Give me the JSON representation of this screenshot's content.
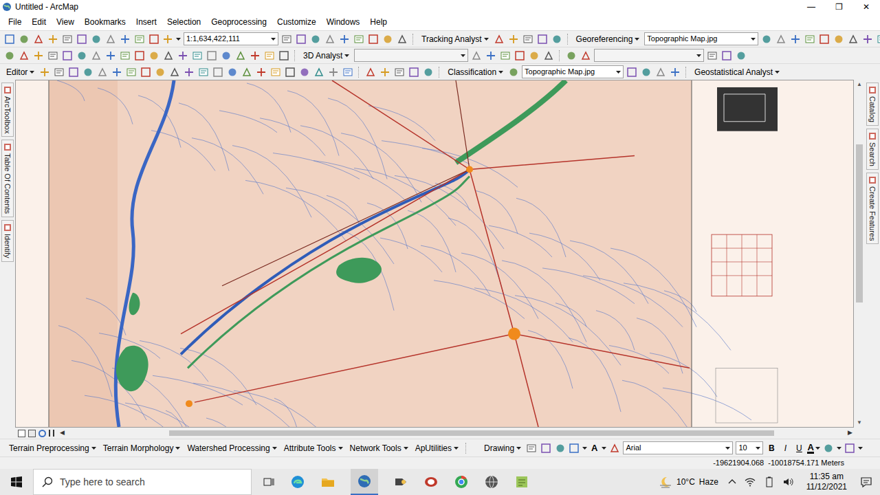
{
  "window": {
    "title": "Untitled - ArcMap",
    "controls": [
      "—",
      "❐",
      "✕"
    ]
  },
  "menu": [
    "File",
    "Edit",
    "View",
    "Bookmarks",
    "Insert",
    "Selection",
    "Geoprocessing",
    "Customize",
    "Windows",
    "Help"
  ],
  "toolbar1": {
    "scale": "1:1,634,422,111",
    "tracking": "Tracking Analyst",
    "georeferencing": "Georeferencing",
    "georef_layer": "Topographic Map.jpg"
  },
  "toolbar2": {
    "analyst3d": "3D Analyst"
  },
  "toolbar3": {
    "editor": "Editor",
    "classification": "Classification",
    "class_layer": "Topographic Map.jpg",
    "geostatistical": "Geostatistical Analyst"
  },
  "left_tabs": [
    "ArcToolbox",
    "Table Of Contents",
    "Identify"
  ],
  "right_tabs": [
    "Catalog",
    "Search",
    "Create Features"
  ],
  "bottom_toolbar": {
    "menus": [
      "Terrain Preprocessing",
      "Terrain Morphology",
      "Watershed Processing",
      "Attribute Tools",
      "Network Tools",
      "ApUtilities"
    ],
    "drawing": "Drawing",
    "font": "Arial",
    "font_size": "10",
    "styles": [
      "B",
      "I",
      "U"
    ],
    "font_color": "A"
  },
  "status_bar": {
    "coordinates": "-19621904.068  -10018754.171 Meters"
  },
  "taskbar": {
    "search_placeholder": "Type here to search",
    "temperature": "10°C",
    "weather": "Haze",
    "time": "11:35 am",
    "date": "11/12/2021"
  }
}
